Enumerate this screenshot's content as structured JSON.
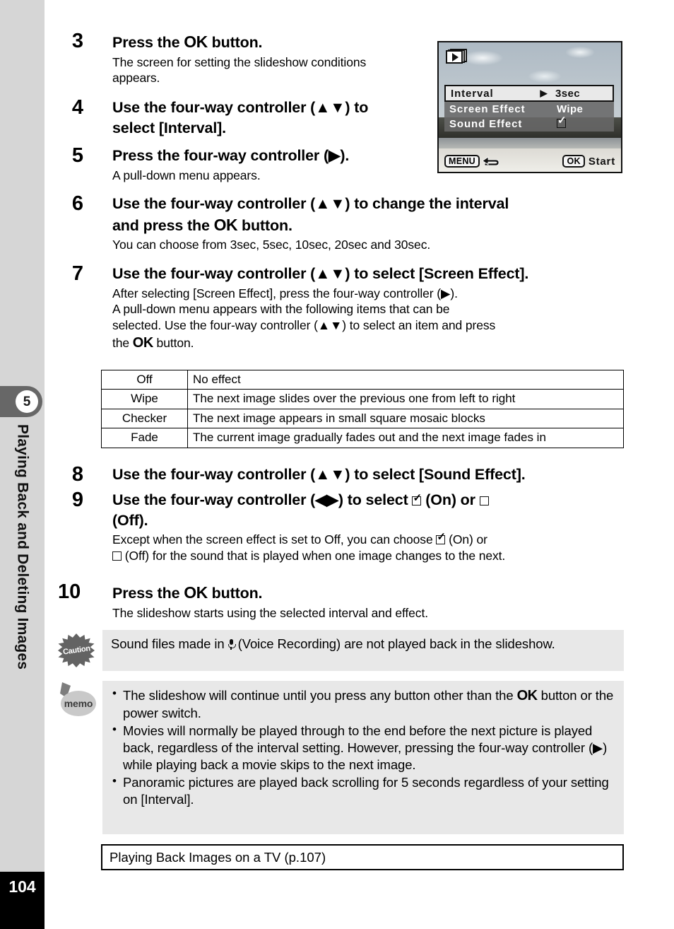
{
  "sidebar": {
    "chapter_number": "5",
    "chapter_title": "Playing Back and Deleting Images",
    "page_number": "104"
  },
  "steps": [
    {
      "number": "3",
      "heading_prefix": "Press the ",
      "heading_ok": "OK",
      "heading_suffix": " button.",
      "description": "The screen for setting the slideshow conditions appears."
    },
    {
      "number": "4",
      "heading": "Use the four-way controller (▲▼) to select [Interval]."
    },
    {
      "number": "5",
      "heading": "Press the four-way controller (▶).",
      "description": "A pull-down menu appears."
    },
    {
      "number": "6",
      "heading_line1": "Use the four-way controller (▲▼) to change the interval",
      "heading_line2_prefix": "and press the ",
      "heading_ok": "OK",
      "heading_line2_suffix": " button.",
      "description": "You can choose from 3sec, 5sec, 10sec, 20sec and 30sec."
    },
    {
      "number": "7",
      "heading": "Use the four-way controller (▲▼) to select [Screen Effect].",
      "desc_line1": "After selecting [Screen Effect], press the four-way controller (▶).",
      "desc_line2": "A pull-down menu appears with the following items that can be",
      "desc_line3": "selected. Use the four-way controller (▲▼) to select an item and press",
      "desc_line4_prefix": "the ",
      "desc_ok": "OK",
      "desc_line4_suffix": " button."
    },
    {
      "number": "8",
      "heading": "Use the four-way controller (▲▼) to select [Sound Effect]."
    },
    {
      "number": "9",
      "heading_part1": "Use the four-way controller (◀▶) to select ",
      "heading_on": " (On) or ",
      "heading_part2": "(Off).",
      "desc_part1": "Except when the screen effect is set to Off, you can choose ",
      "desc_on": " (On) or",
      "desc_part2": " (Off) for the sound that is played when one image changes to the next."
    },
    {
      "number": "10",
      "heading_prefix": "Press the ",
      "heading_ok": "OK",
      "heading_suffix": " button.",
      "description": "The slideshow starts using the selected interval and effect."
    }
  ],
  "lcd": {
    "icon_name": "slideshow-playback-icon",
    "rows": [
      {
        "label": "Interval",
        "arrow": "▶",
        "value": "3sec",
        "selected": true
      },
      {
        "label": "Screen Effect",
        "arrow": "",
        "value": "Wipe",
        "selected": false
      },
      {
        "label": "Sound Effect",
        "arrow": "",
        "value": "checkbox-checked",
        "selected": false
      }
    ],
    "menu_button": "MENU",
    "menu_action_icon": "back-arrow-icon",
    "ok_button": "OK",
    "ok_label": "Start"
  },
  "effects_table": {
    "rows": [
      {
        "key": "Off",
        "desc": "No effect"
      },
      {
        "key": "Wipe",
        "desc": "The next image slides over the previous one from left to right"
      },
      {
        "key": "Checker",
        "desc": "The next image appears in small square mosaic blocks"
      },
      {
        "key": "Fade",
        "desc": "The current image gradually fades out and the next image fades in"
      }
    ]
  },
  "caution": {
    "icon_label": "Caution",
    "text_part1": "Sound files made in ",
    "text_part2": " (Voice Recording) are not played back in the slideshow."
  },
  "memo": {
    "icon_label": "memo",
    "items": [
      {
        "prefix": "The slideshow will continue until you press any button other than the ",
        "ok": "OK",
        "suffix": " button or the power switch."
      },
      {
        "prefix": "Movies will normally be played through to the end before the next picture is played back, regardless of the interval setting. However, pressing the four-way controller (▶) while playing back a movie skips to the next image."
      },
      {
        "prefix": "Panoramic pictures are played back scrolling for 5 seconds regardless of your setting on [Interval]."
      }
    ]
  },
  "reference": {
    "text": "Playing Back Images on a TV (p.107)"
  },
  "colors": {
    "sidebar_bg": "#d6d6d6",
    "chapter_tab_bg": "#676767",
    "note_bg": "#e8e8e8",
    "page_num_bg": "#000000"
  }
}
